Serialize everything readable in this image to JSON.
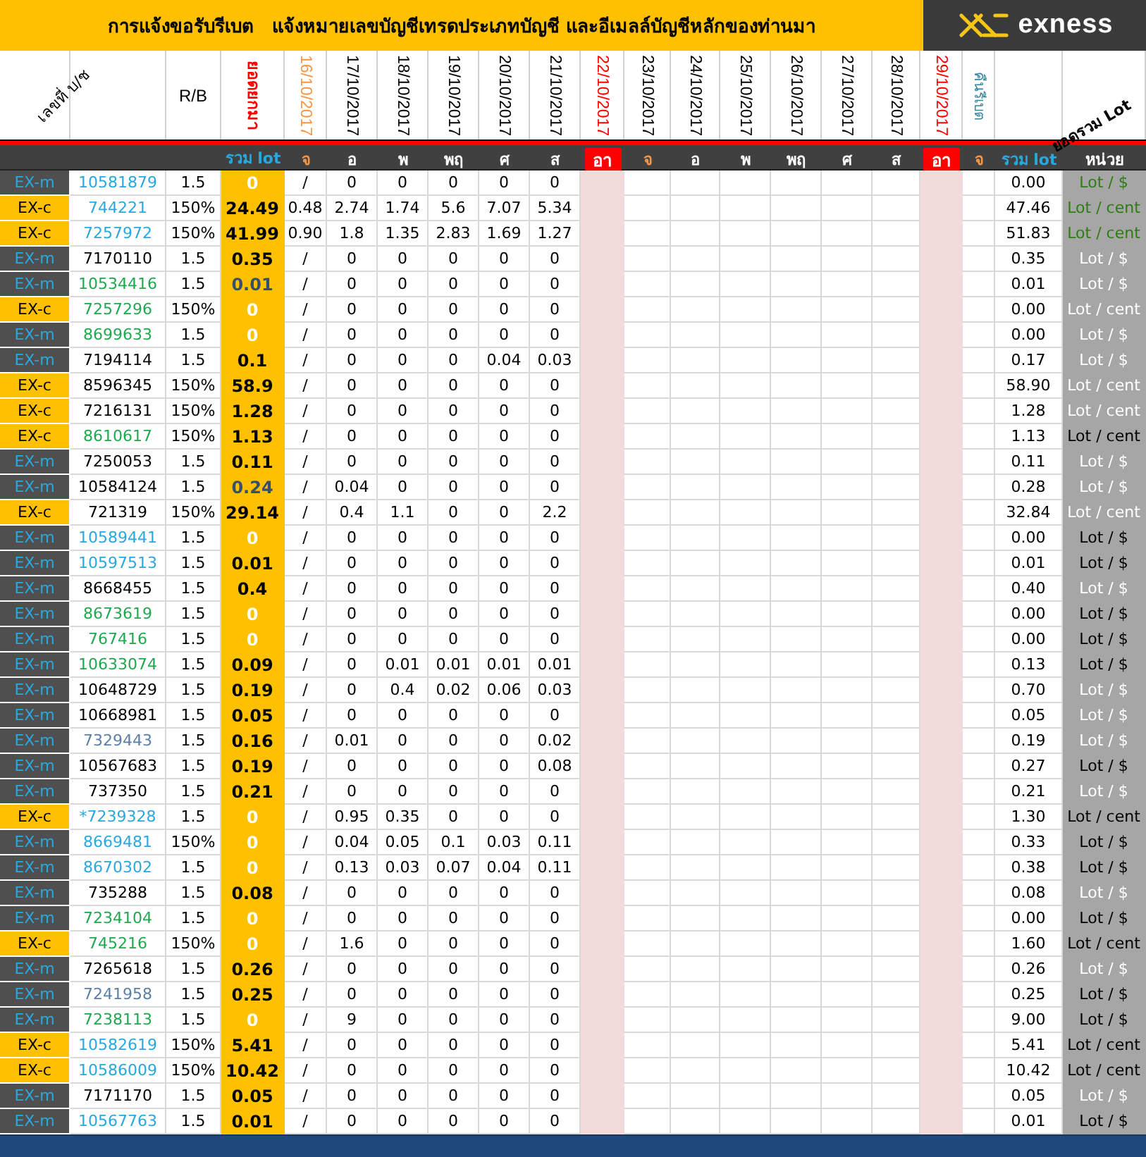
{
  "title": "การแจ้งขอรับรีเบต   แจ้งหมายเลขบัญชีเทรดประเภทบัญชี และอีเมลล์บัญชีหลักของท่านมา",
  "logo_text": "exness",
  "header": {
    "account_label": "เลขที่ บ/ช",
    "rb_label": "R/B",
    "carried_label": "ยอดยกมา",
    "rebate_label": "คืนรีเบต",
    "sum_label": "ยอดรวม Lot",
    "dates": [
      {
        "text": "16/10/2017",
        "color": "#f79646"
      },
      {
        "text": "17/10/2017",
        "color": "#000000"
      },
      {
        "text": "18/10/2017",
        "color": "#000000"
      },
      {
        "text": "19/10/2017",
        "color": "#000000"
      },
      {
        "text": "20/10/2017",
        "color": "#000000"
      },
      {
        "text": "21/10/2017",
        "color": "#000000"
      },
      {
        "text": "22/10/2017",
        "color": "#ff0000"
      },
      {
        "text": "23/10/2017",
        "color": "#000000"
      },
      {
        "text": "24/10/2017",
        "color": "#000000"
      },
      {
        "text": "25/10/2017",
        "color": "#000000"
      },
      {
        "text": "26/10/2017",
        "color": "#000000"
      },
      {
        "text": "27/10/2017",
        "color": "#000000"
      },
      {
        "text": "28/10/2017",
        "color": "#000000"
      },
      {
        "text": "29/10/2017",
        "color": "#ff0000"
      }
    ]
  },
  "subheader": {
    "total_label": "รวม lot",
    "sum_label": "รวม lot",
    "unit_label": "หน่วย",
    "days": [
      {
        "text": "จ",
        "color": "#f79646",
        "highlighted": false
      },
      {
        "text": "อ",
        "color": "#ffffff",
        "highlighted": false
      },
      {
        "text": "พ",
        "color": "#ffffff",
        "highlighted": false
      },
      {
        "text": "พฤ",
        "color": "#ffffff",
        "highlighted": false
      },
      {
        "text": "ศ",
        "color": "#ffffff",
        "highlighted": false
      },
      {
        "text": "ส",
        "color": "#ffffff",
        "highlighted": false
      },
      {
        "text": "อา",
        "highlighted": true
      },
      {
        "text": "จ",
        "color": "#f79646",
        "highlighted": false
      },
      {
        "text": "อ",
        "color": "#ffffff",
        "highlighted": false
      },
      {
        "text": "พ",
        "color": "#ffffff",
        "highlighted": false
      },
      {
        "text": "พฤ",
        "color": "#ffffff",
        "highlighted": false
      },
      {
        "text": "ศ",
        "color": "#ffffff",
        "highlighted": false
      },
      {
        "text": "ส",
        "color": "#ffffff",
        "highlighted": false
      },
      {
        "text": "อา",
        "highlighted": true
      },
      {
        "text": "จ",
        "color": "#f79646",
        "highlighted": false
      }
    ]
  },
  "rows": [
    {
      "kind": "m",
      "type": "EX-m",
      "account": {
        "text": "10581879",
        "color": "#29a8e0"
      },
      "rb": "1.5",
      "total": {
        "text": "0",
        "color": "#ffffff"
      },
      "days": [
        "/",
        "0",
        "0",
        "0",
        "0",
        "0"
      ],
      "sum": "0.00",
      "unit": {
        "text": "Lot / $",
        "color": "#2e7d12"
      }
    },
    {
      "kind": "c",
      "type": "EX-c",
      "account": {
        "text": "744221",
        "color": "#29a8e0"
      },
      "rb": "150%",
      "total": {
        "text": "24.49",
        "color": "#000000"
      },
      "days": [
        "0.48",
        "2.74",
        "1.74",
        "5.6",
        "7.07",
        "5.34"
      ],
      "sum": "47.46",
      "unit": {
        "text": "Lot / cent",
        "color": "#2e7d12"
      }
    },
    {
      "kind": "c",
      "type": "EX-c",
      "account": {
        "text": "7257972",
        "color": "#29a8e0"
      },
      "rb": "150%",
      "total": {
        "text": "41.99",
        "color": "#000000"
      },
      "days": [
        "0.90",
        "1.8",
        "1.35",
        "2.83",
        "1.69",
        "1.27"
      ],
      "sum": "51.83",
      "unit": {
        "text": "Lot / cent",
        "color": "#2e7d12"
      }
    },
    {
      "kind": "m",
      "type": "EX-m",
      "account": {
        "text": "7170110",
        "color": "#000000"
      },
      "rb": "1.5",
      "total": {
        "text": "0.35",
        "color": "#000000"
      },
      "days": [
        "/",
        "0",
        "0",
        "0",
        "0",
        "0"
      ],
      "sum": "0.35",
      "unit": {
        "text": "Lot / $",
        "color": "#ffffff"
      }
    },
    {
      "kind": "m",
      "type": "EX-m",
      "account": {
        "text": "10534416",
        "color": "#1fa84f"
      },
      "rb": "1.5",
      "total": {
        "text": "0.01",
        "color": "#34506e"
      },
      "days": [
        "/",
        "0",
        "0",
        "0",
        "0",
        "0"
      ],
      "sum": "0.01",
      "unit": {
        "text": "Lot / $",
        "color": "#ffffff"
      }
    },
    {
      "kind": "c",
      "type": "EX-c",
      "account": {
        "text": "7257296",
        "color": "#1fa84f"
      },
      "rb": "150%",
      "total": {
        "text": "0",
        "color": "#ffffff"
      },
      "days": [
        "/",
        "0",
        "0",
        "0",
        "0",
        "0"
      ],
      "sum": "0.00",
      "unit": {
        "text": "Lot / cent",
        "color": "#ffffff"
      }
    },
    {
      "kind": "m",
      "type": "EX-m",
      "account": {
        "text": "8699633",
        "color": "#1fa84f"
      },
      "rb": "1.5",
      "total": {
        "text": "0",
        "color": "#ffffff"
      },
      "days": [
        "/",
        "0",
        "0",
        "0",
        "0",
        "0"
      ],
      "sum": "0.00",
      "unit": {
        "text": "Lot / $",
        "color": "#ffffff"
      }
    },
    {
      "kind": "m",
      "type": "EX-m",
      "account": {
        "text": "7194114",
        "color": "#000000"
      },
      "rb": "1.5",
      "total": {
        "text": "0.1",
        "color": "#000000"
      },
      "days": [
        "/",
        "0",
        "0",
        "0",
        "0.04",
        "0.03"
      ],
      "sum": "0.17",
      "unit": {
        "text": "Lot / $",
        "color": "#ffffff"
      }
    },
    {
      "kind": "c",
      "type": "EX-c",
      "account": {
        "text": "8596345",
        "color": "#000000"
      },
      "rb": "150%",
      "total": {
        "text": "58.9",
        "color": "#000000"
      },
      "days": [
        "/",
        "0",
        "0",
        "0",
        "0",
        "0"
      ],
      "sum": "58.90",
      "unit": {
        "text": "Lot / cent",
        "color": "#ffffff"
      }
    },
    {
      "kind": "c",
      "type": "EX-c",
      "account": {
        "text": "7216131",
        "color": "#000000"
      },
      "rb": "150%",
      "total": {
        "text": "1.28",
        "color": "#000000"
      },
      "days": [
        "/",
        "0",
        "0",
        "0",
        "0",
        "0"
      ],
      "sum": "1.28",
      "unit": {
        "text": "Lot / cent",
        "color": "#ffffff"
      }
    },
    {
      "kind": "c",
      "type": "EX-c",
      "account": {
        "text": "8610617",
        "color": "#1fa84f"
      },
      "rb": "150%",
      "total": {
        "text": "1.13",
        "color": "#000000"
      },
      "days": [
        "/",
        "0",
        "0",
        "0",
        "0",
        "0"
      ],
      "sum": "1.13",
      "unit": {
        "text": "Lot / cent",
        "color": "#000000"
      }
    },
    {
      "kind": "m",
      "type": "EX-m",
      "account": {
        "text": "7250053",
        "color": "#000000"
      },
      "rb": "1.5",
      "total": {
        "text": "0.11",
        "color": "#000000"
      },
      "days": [
        "/",
        "0",
        "0",
        "0",
        "0",
        "0"
      ],
      "sum": "0.11",
      "unit": {
        "text": "Lot / $",
        "color": "#ffffff"
      }
    },
    {
      "kind": "m",
      "type": "EX-m",
      "account": {
        "text": "10584124",
        "color": "#000000"
      },
      "rb": "1.5",
      "total": {
        "text": "0.24",
        "color": "#34506e"
      },
      "days": [
        "/",
        "0.04",
        "0",
        "0",
        "0",
        "0"
      ],
      "sum": "0.28",
      "unit": {
        "text": "Lot / $",
        "color": "#ffffff"
      }
    },
    {
      "kind": "c",
      "type": "EX-c",
      "account": {
        "text": "721319",
        "color": "#000000"
      },
      "rb": "150%",
      "total": {
        "text": "29.14",
        "color": "#000000"
      },
      "days": [
        "/",
        "0.4",
        "1.1",
        "0",
        "0",
        "2.2"
      ],
      "sum": "32.84",
      "unit": {
        "text": "Lot / cent",
        "color": "#ffffff"
      }
    },
    {
      "kind": "m",
      "type": "EX-m",
      "account": {
        "text": "10589441",
        "color": "#29a8e0"
      },
      "rb": "1.5",
      "total": {
        "text": "0",
        "color": "#ffffff"
      },
      "days": [
        "/",
        "0",
        "0",
        "0",
        "0",
        "0"
      ],
      "sum": "0.00",
      "unit": {
        "text": "Lot / $",
        "color": "#000000"
      }
    },
    {
      "kind": "m",
      "type": "EX-m",
      "account": {
        "text": "10597513",
        "color": "#29a8e0"
      },
      "rb": "1.5",
      "total": {
        "text": "0.01",
        "color": "#000000"
      },
      "days": [
        "/",
        "0",
        "0",
        "0",
        "0",
        "0"
      ],
      "sum": "0.01",
      "unit": {
        "text": "Lot / $",
        "color": "#000000"
      }
    },
    {
      "kind": "m",
      "type": "EX-m",
      "account": {
        "text": "8668455",
        "color": "#000000"
      },
      "rb": "1.5",
      "total": {
        "text": "0.4",
        "color": "#000000"
      },
      "days": [
        "/",
        "0",
        "0",
        "0",
        "0",
        "0"
      ],
      "sum": "0.40",
      "unit": {
        "text": "Lot / $",
        "color": "#ffffff"
      }
    },
    {
      "kind": "m",
      "type": "EX-m",
      "account": {
        "text": "8673619",
        "color": "#1fa84f"
      },
      "rb": "1.5",
      "total": {
        "text": "0",
        "color": "#ffffff"
      },
      "days": [
        "/",
        "0",
        "0",
        "0",
        "0",
        "0"
      ],
      "sum": "0.00",
      "unit": {
        "text": "Lot / $",
        "color": "#000000"
      }
    },
    {
      "kind": "m",
      "type": "EX-m",
      "account": {
        "text": "767416",
        "color": "#1fa84f"
      },
      "rb": "1.5",
      "total": {
        "text": "0",
        "color": "#ffffff"
      },
      "days": [
        "/",
        "0",
        "0",
        "0",
        "0",
        "0"
      ],
      "sum": "0.00",
      "unit": {
        "text": "Lot / $",
        "color": "#000000"
      }
    },
    {
      "kind": "m",
      "type": "EX-m",
      "account": {
        "text": "10633074",
        "color": "#1fa84f"
      },
      "rb": "1.5",
      "total": {
        "text": "0.09",
        "color": "#000000"
      },
      "days": [
        "/",
        "0",
        "0.01",
        "0.01",
        "0.01",
        "0.01"
      ],
      "sum": "0.13",
      "unit": {
        "text": "Lot / $",
        "color": "#000000"
      }
    },
    {
      "kind": "m",
      "type": "EX-m",
      "account": {
        "text": "10648729",
        "color": "#000000"
      },
      "rb": "1.5",
      "total": {
        "text": "0.19",
        "color": "#000000"
      },
      "days": [
        "/",
        "0",
        "0.4",
        "0.02",
        "0.06",
        "0.03"
      ],
      "sum": "0.70",
      "unit": {
        "text": "Lot / $",
        "color": "#ffffff"
      }
    },
    {
      "kind": "m",
      "type": "EX-m",
      "account": {
        "text": "10668981",
        "color": "#000000"
      },
      "rb": "1.5",
      "total": {
        "text": "0.05",
        "color": "#000000"
      },
      "days": [
        "/",
        "0",
        "0",
        "0",
        "0",
        "0"
      ],
      "sum": "0.05",
      "unit": {
        "text": "Lot / $",
        "color": "#ffffff"
      }
    },
    {
      "kind": "m",
      "type": "EX-m",
      "account": {
        "text": "7329443",
        "color": "#5b7fa8"
      },
      "rb": "1.5",
      "total": {
        "text": "0.16",
        "color": "#000000"
      },
      "days": [
        "/",
        "0.01",
        "0",
        "0",
        "0",
        "0.02"
      ],
      "sum": "0.19",
      "unit": {
        "text": "Lot / $",
        "color": "#ffffff"
      }
    },
    {
      "kind": "m",
      "type": "EX-m",
      "account": {
        "text": "10567683",
        "color": "#000000"
      },
      "rb": "1.5",
      "total": {
        "text": "0.19",
        "color": "#000000"
      },
      "days": [
        "/",
        "0",
        "0",
        "0",
        "0",
        "0.08"
      ],
      "sum": "0.27",
      "unit": {
        "text": "Lot / $",
        "color": "#000000"
      }
    },
    {
      "kind": "m",
      "type": "EX-m",
      "account": {
        "text": "737350",
        "color": "#000000"
      },
      "rb": "1.5",
      "total": {
        "text": "0.21",
        "color": "#000000"
      },
      "days": [
        "/",
        "0",
        "0",
        "0",
        "0",
        "0"
      ],
      "sum": "0.21",
      "unit": {
        "text": "Lot / $",
        "color": "#ffffff"
      }
    },
    {
      "kind": "c",
      "type": "EX-c",
      "account": {
        "text": "*7239328",
        "color": "#29a8e0"
      },
      "rb": "1.5",
      "total": {
        "text": "0",
        "color": "#ffffff"
      },
      "days": [
        "/",
        "0.95",
        "0.35",
        "0",
        "0",
        "0"
      ],
      "sum": "1.30",
      "unit": {
        "text": "Lot / cent",
        "color": "#000000"
      }
    },
    {
      "kind": "m",
      "type": "EX-m",
      "account": {
        "text": "8669481",
        "color": "#29a8e0"
      },
      "rb": "150%",
      "total": {
        "text": "0",
        "color": "#ffffff"
      },
      "days": [
        "/",
        "0.04",
        "0.05",
        "0.1",
        "0.03",
        "0.11"
      ],
      "sum": "0.33",
      "unit": {
        "text": "Lot / $",
        "color": "#000000"
      }
    },
    {
      "kind": "m",
      "type": "EX-m",
      "account": {
        "text": "8670302",
        "color": "#29a8e0"
      },
      "rb": "1.5",
      "total": {
        "text": "0",
        "color": "#ffffff"
      },
      "days": [
        "/",
        "0.13",
        "0.03",
        "0.07",
        "0.04",
        "0.11"
      ],
      "sum": "0.38",
      "unit": {
        "text": "Lot / $",
        "color": "#000000"
      }
    },
    {
      "kind": "m",
      "type": "EX-m",
      "account": {
        "text": "735288",
        "color": "#000000"
      },
      "rb": "1.5",
      "total": {
        "text": "0.08",
        "color": "#000000"
      },
      "days": [
        "/",
        "0",
        "0",
        "0",
        "0",
        "0"
      ],
      "sum": "0.08",
      "unit": {
        "text": "Lot / $",
        "color": "#ffffff"
      }
    },
    {
      "kind": "m",
      "type": "EX-m",
      "account": {
        "text": "7234104",
        "color": "#1fa84f"
      },
      "rb": "1.5",
      "total": {
        "text": "0",
        "color": "#ffffff"
      },
      "days": [
        "/",
        "0",
        "0",
        "0",
        "0",
        "0"
      ],
      "sum": "0.00",
      "unit": {
        "text": "Lot / $",
        "color": "#000000"
      }
    },
    {
      "kind": "c",
      "type": "EX-c",
      "account": {
        "text": "745216",
        "color": "#1fa84f"
      },
      "rb": "150%",
      "total": {
        "text": "0",
        "color": "#ffffff"
      },
      "days": [
        "/",
        "1.6",
        "0",
        "0",
        "0",
        "0"
      ],
      "sum": "1.60",
      "unit": {
        "text": "Lot / cent",
        "color": "#000000"
      }
    },
    {
      "kind": "m",
      "type": "EX-m",
      "account": {
        "text": "7265618",
        "color": "#000000"
      },
      "rb": "1.5",
      "total": {
        "text": "0.26",
        "color": "#000000"
      },
      "days": [
        "/",
        "0",
        "0",
        "0",
        "0",
        "0"
      ],
      "sum": "0.26",
      "unit": {
        "text": "Lot / $",
        "color": "#ffffff"
      }
    },
    {
      "kind": "m",
      "type": "EX-m",
      "account": {
        "text": "7241958",
        "color": "#5b7fa8"
      },
      "rb": "1.5",
      "total": {
        "text": "0.25",
        "color": "#000000"
      },
      "days": [
        "/",
        "0",
        "0",
        "0",
        "0",
        "0"
      ],
      "sum": "0.25",
      "unit": {
        "text": "Lot / $",
        "color": "#000000"
      }
    },
    {
      "kind": "m",
      "type": "EX-m",
      "account": {
        "text": "7238113",
        "color": "#1fa84f"
      },
      "rb": "1.5",
      "total": {
        "text": "0",
        "color": "#ffffff"
      },
      "days": [
        "/",
        "9",
        "0",
        "0",
        "0",
        "0"
      ],
      "sum": "9.00",
      "unit": {
        "text": "Lot / $",
        "color": "#000000"
      }
    },
    {
      "kind": "c",
      "type": "EX-c",
      "account": {
        "text": "10582619",
        "color": "#29a8e0"
      },
      "rb": "150%",
      "total": {
        "text": "5.41",
        "color": "#000000"
      },
      "days": [
        "/",
        "0",
        "0",
        "0",
        "0",
        "0"
      ],
      "sum": "5.41",
      "unit": {
        "text": "Lot / cent",
        "color": "#000000"
      }
    },
    {
      "kind": "c",
      "type": "EX-c",
      "account": {
        "text": "10586009",
        "color": "#29a8e0"
      },
      "rb": "150%",
      "total": {
        "text": "10.42",
        "color": "#000000"
      },
      "days": [
        "/",
        "0",
        "0",
        "0",
        "0",
        "0"
      ],
      "sum": "10.42",
      "unit": {
        "text": "Lot / cent",
        "color": "#000000"
      }
    },
    {
      "kind": "m",
      "type": "EX-m",
      "account": {
        "text": "7171170",
        "color": "#000000"
      },
      "rb": "1.5",
      "total": {
        "text": "0.05",
        "color": "#000000"
      },
      "days": [
        "/",
        "0",
        "0",
        "0",
        "0",
        "0"
      ],
      "sum": "0.05",
      "unit": {
        "text": "Lot / $",
        "color": "#ffffff"
      }
    },
    {
      "kind": "m",
      "type": "EX-m",
      "account": {
        "text": "10567763",
        "color": "#29a8e0"
      },
      "rb": "1.5",
      "total": {
        "text": "0.01",
        "color": "#000000"
      },
      "days": [
        "/",
        "0",
        "0",
        "0",
        "0",
        "0"
      ],
      "sum": "0.01",
      "unit": {
        "text": "Lot / $",
        "color": "#000000"
      }
    }
  ]
}
